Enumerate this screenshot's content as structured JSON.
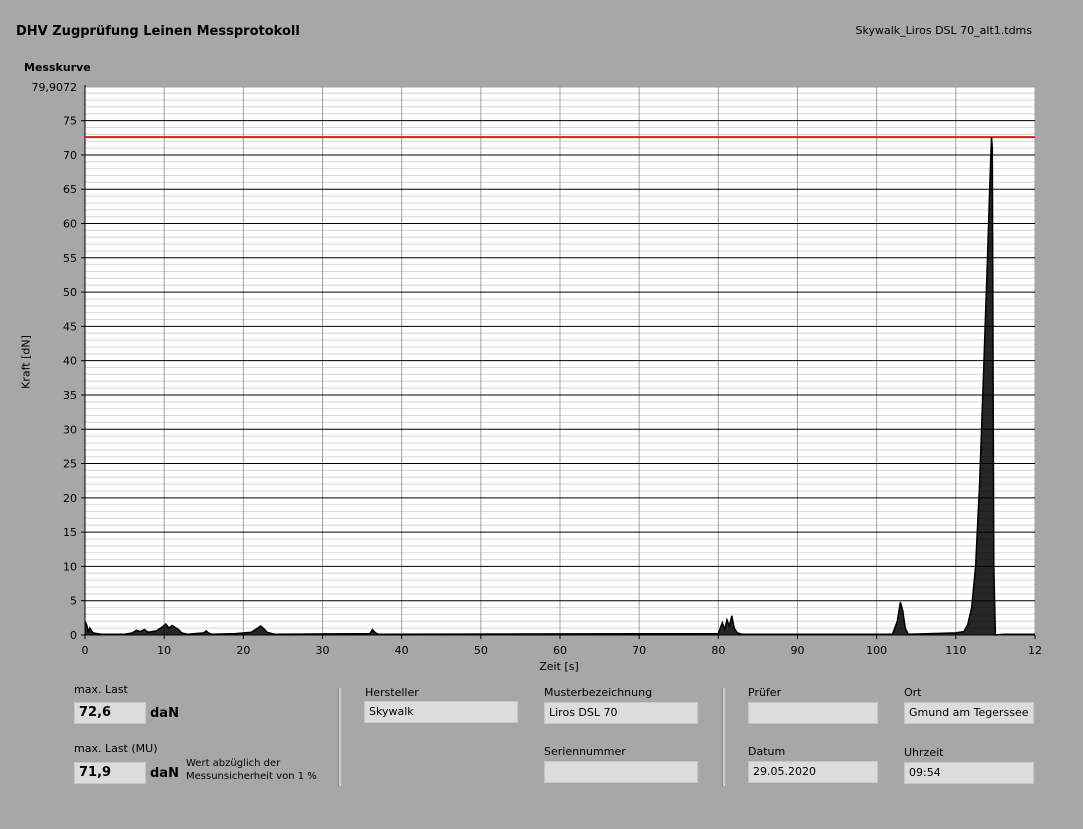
{
  "header": {
    "title": "DHV Zugprüfung Leinen Messprotokoll",
    "filename": "Skywalk_Liros DSL 70_alt1.tdms"
  },
  "chart_data": {
    "type": "line",
    "title": "Messkurve",
    "xlabel": "Zeit [s]",
    "ylabel": "Kraft [dN]",
    "xlim": [
      0,
      120
    ],
    "ylim": [
      0,
      79.9072
    ],
    "y_top_label": "79,9072",
    "x_ticks": [
      0,
      10,
      20,
      30,
      40,
      50,
      60,
      70,
      80,
      90,
      100,
      110,
      120
    ],
    "x_tick_labels": [
      "0",
      "10",
      "20",
      "30",
      "40",
      "50",
      "60",
      "70",
      "80",
      "90",
      "100",
      "110",
      "12"
    ],
    "y_ticks": [
      0,
      5,
      10,
      15,
      20,
      25,
      30,
      35,
      40,
      45,
      50,
      55,
      60,
      65,
      70,
      75
    ],
    "grid": true,
    "threshold": {
      "value": 72.6,
      "color": "#d42020"
    },
    "series": [
      {
        "color": "#000000",
        "x": [
          0,
          0.2,
          0.4,
          0.6,
          1,
          2,
          5,
          6,
          6.5,
          7,
          7.5,
          8,
          9,
          9.8,
          10.2,
          10.6,
          11,
          11.4,
          11.8,
          12.2,
          13,
          15,
          15.3,
          15.6,
          16,
          19,
          21,
          21.8,
          22.2,
          22.6,
          23,
          24,
          36,
          36.3,
          36.6,
          37,
          80,
          80.5,
          80.8,
          81.1,
          81.4,
          81.7,
          82,
          82.4,
          83,
          102,
          102.6,
          103,
          103.3,
          103.6,
          104,
          110,
          111,
          111.5,
          112,
          112.5,
          113,
          113.5,
          114,
          114.3,
          114.5,
          114.6,
          114.8,
          115,
          116,
          120
        ],
        "y": [
          2,
          1.5,
          0.5,
          1,
          0.3,
          0.1,
          0.1,
          0.3,
          0.7,
          0.5,
          0.8,
          0.4,
          0.6,
          1.2,
          1.6,
          1.0,
          1.4,
          1.1,
          0.8,
          0.3,
          0.1,
          0.3,
          0.6,
          0.3,
          0.1,
          0.2,
          0.4,
          1.0,
          1.3,
          0.9,
          0.4,
          0.1,
          0.2,
          0.8,
          0.4,
          0.1,
          0.2,
          1.8,
          0.8,
          2.2,
          1.3,
          2.8,
          1.0,
          0.3,
          0.1,
          0.1,
          2.0,
          4.8,
          3.5,
          1.0,
          0.1,
          0.3,
          0.5,
          1.5,
          4,
          10,
          22,
          38,
          55,
          66,
          72.6,
          71,
          10,
          0,
          0.1,
          0.1
        ]
      }
    ]
  },
  "summary": {
    "max_last_label": "max. Last",
    "max_last_value": "72,6",
    "max_last_unit": "daN",
    "max_last_mu_label": "max. Last (MU)",
    "max_last_mu_value": "71,9",
    "max_last_mu_unit": "daN",
    "note_line1": "Wert abzüglich der",
    "note_line2": "Messunsicherheit von 1 %"
  },
  "info": {
    "hersteller_label": "Hersteller",
    "hersteller_value": "Skywalk",
    "muster_label": "Musterbezeichnung",
    "muster_value": "Liros DSL 70",
    "serien_label": "Seriennummer",
    "serien_value": "",
    "pruefer_label": "Prüfer",
    "pruefer_value": "",
    "ort_label": "Ort",
    "ort_value": "Gmund am Tegerssee",
    "datum_label": "Datum",
    "datum_value": "29.05.2020",
    "uhrzeit_label": "Uhrzeit",
    "uhrzeit_value": "09:54"
  }
}
